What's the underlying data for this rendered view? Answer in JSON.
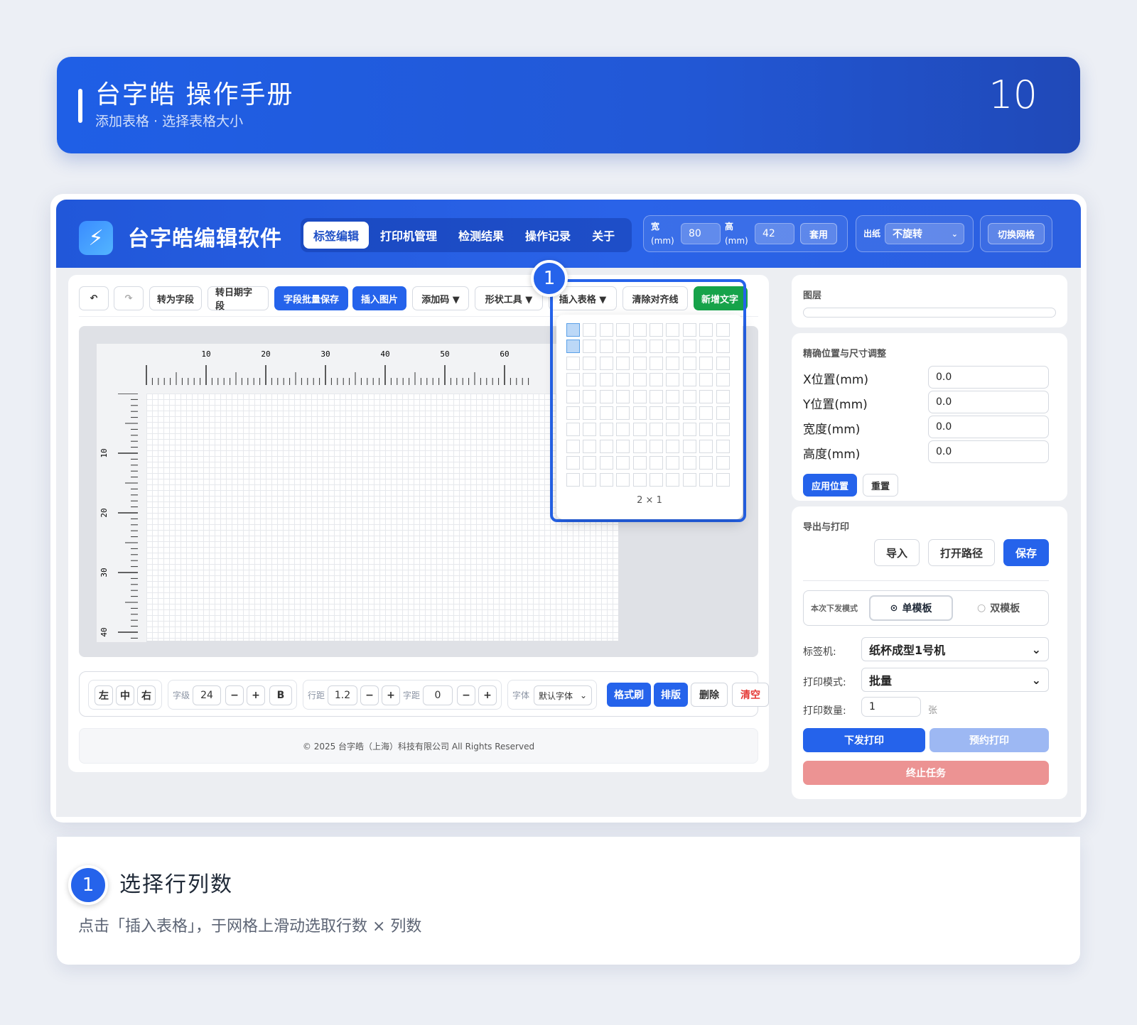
{
  "banner": {
    "title": "台字皓 操作手册",
    "subtitle": "添加表格 · 选择表格大小",
    "page_number": "10"
  },
  "app": {
    "name": "台字皓编辑软件",
    "nav": [
      "标签编辑",
      "打印机管理",
      "检测结果",
      "操作记录",
      "关于"
    ],
    "active_nav": "标签编辑",
    "size": {
      "width_label": "宽",
      "width_unit": "(mm)",
      "width_value": "80",
      "height_label": "高",
      "height_unit": "(mm)",
      "height_value": "42",
      "apply_label": "套用"
    },
    "paper_out_label": "出纸",
    "rotation_value": "不旋转",
    "grid_toggle_label": "切换网格"
  },
  "toolbar": {
    "undo_icon": "undo-icon",
    "redo_icon": "redo-icon",
    "to_field": "转为字段",
    "to_date_field": "转日期字段",
    "batch_save": "字段批量保存",
    "insert_image": "插入图片",
    "add_code": "添加码 ▼",
    "shape_tool": "形状工具 ▼",
    "insert_table": "插入表格 ▼",
    "clear_guides": "清除对齐线",
    "add_text": "新增文字"
  },
  "ruler": {
    "h_labels": [
      "10",
      "20",
      "30",
      "40",
      "50",
      "60"
    ],
    "v_labels": [
      "10",
      "20",
      "30",
      "40"
    ]
  },
  "table_picker": {
    "rows": 10,
    "cols": 10,
    "selected_rows": 2,
    "selected_cols": 1,
    "size_label": "2 × 1"
  },
  "format_bar": {
    "align": [
      "左",
      "中",
      "右"
    ],
    "font_size_label": "字级",
    "font_size_value": "24",
    "minus": "−",
    "plus": "+",
    "bold": "B",
    "line_height_label": "行距",
    "line_height_value": "1.2",
    "letter_spacing_label": "字距",
    "letter_spacing_value": "0",
    "font_label": "字体",
    "font_value": "默认字体",
    "format_painter": "格式刷",
    "layout": "排版",
    "delete": "删除",
    "clear": "清空"
  },
  "footer": "© 2025 台字皓（上海）科技有限公司 All Rights Reserved",
  "right_panel": {
    "layers_title": "图层",
    "position_title": "精确位置与尺寸调整",
    "fields": [
      {
        "label": "X位置(mm)",
        "value": "0.0"
      },
      {
        "label": "Y位置(mm)",
        "value": "0.0"
      },
      {
        "label": "宽度(mm)",
        "value": "0.0"
      },
      {
        "label": "高度(mm)",
        "value": "0.0"
      }
    ],
    "apply_position": "应用位置",
    "reset": "重置",
    "export_title": "导出与打印",
    "import": "导入",
    "open_path": "打开路径",
    "save": "保存",
    "send_mode_label": "本次下发模式",
    "single_template": "单模板",
    "double_template": "双模板",
    "labeler_label": "标签机:",
    "labeler_value": "纸杯成型1号机",
    "print_mode_label": "打印模式:",
    "print_mode_value": "批量",
    "print_count_label": "打印数量:",
    "print_count_value": "1",
    "print_count_unit": "张",
    "send_print": "下发打印",
    "schedule_print": "预约打印",
    "stop_task": "终止任务"
  },
  "step": {
    "number": "1",
    "title": "选择行列数",
    "description": "点击「插入表格」，于网格上滑动选取行数 × 列数"
  },
  "colors": {
    "primary": "#2563eb",
    "success": "#16a34a",
    "danger": "#e53935",
    "stop_button": "#ec9393"
  }
}
